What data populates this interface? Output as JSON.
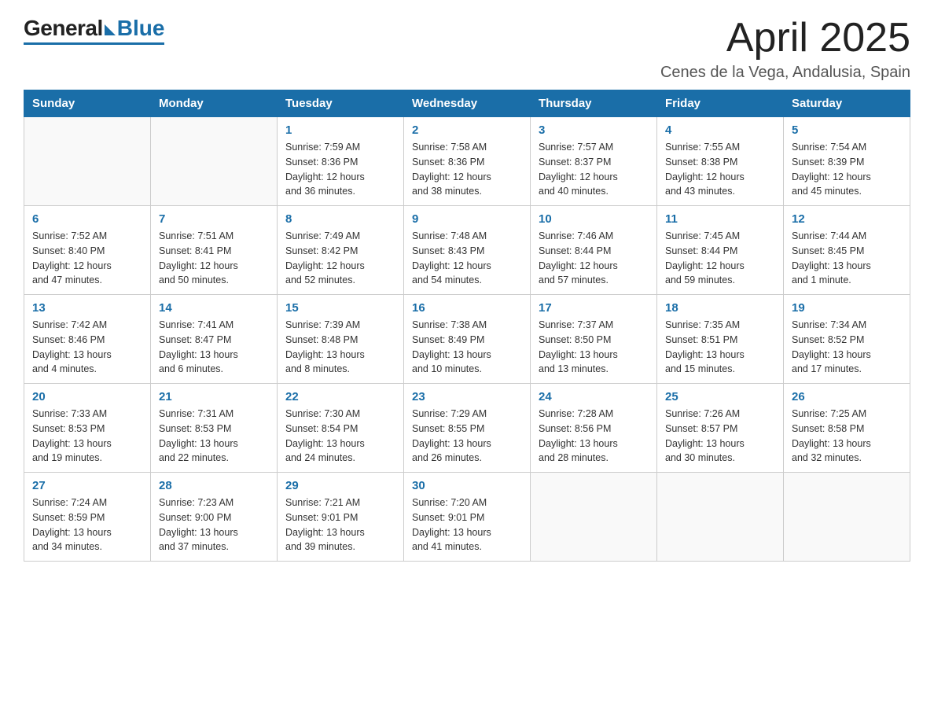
{
  "header": {
    "logo": {
      "general": "General",
      "blue": "Blue"
    },
    "title": "April 2025",
    "location": "Cenes de la Vega, Andalusia, Spain"
  },
  "calendar": {
    "weekdays": [
      "Sunday",
      "Monday",
      "Tuesday",
      "Wednesday",
      "Thursday",
      "Friday",
      "Saturday"
    ],
    "weeks": [
      [
        {
          "day": "",
          "info": ""
        },
        {
          "day": "",
          "info": ""
        },
        {
          "day": "1",
          "info": "Sunrise: 7:59 AM\nSunset: 8:36 PM\nDaylight: 12 hours\nand 36 minutes."
        },
        {
          "day": "2",
          "info": "Sunrise: 7:58 AM\nSunset: 8:36 PM\nDaylight: 12 hours\nand 38 minutes."
        },
        {
          "day": "3",
          "info": "Sunrise: 7:57 AM\nSunset: 8:37 PM\nDaylight: 12 hours\nand 40 minutes."
        },
        {
          "day": "4",
          "info": "Sunrise: 7:55 AM\nSunset: 8:38 PM\nDaylight: 12 hours\nand 43 minutes."
        },
        {
          "day": "5",
          "info": "Sunrise: 7:54 AM\nSunset: 8:39 PM\nDaylight: 12 hours\nand 45 minutes."
        }
      ],
      [
        {
          "day": "6",
          "info": "Sunrise: 7:52 AM\nSunset: 8:40 PM\nDaylight: 12 hours\nand 47 minutes."
        },
        {
          "day": "7",
          "info": "Sunrise: 7:51 AM\nSunset: 8:41 PM\nDaylight: 12 hours\nand 50 minutes."
        },
        {
          "day": "8",
          "info": "Sunrise: 7:49 AM\nSunset: 8:42 PM\nDaylight: 12 hours\nand 52 minutes."
        },
        {
          "day": "9",
          "info": "Sunrise: 7:48 AM\nSunset: 8:43 PM\nDaylight: 12 hours\nand 54 minutes."
        },
        {
          "day": "10",
          "info": "Sunrise: 7:46 AM\nSunset: 8:44 PM\nDaylight: 12 hours\nand 57 minutes."
        },
        {
          "day": "11",
          "info": "Sunrise: 7:45 AM\nSunset: 8:44 PM\nDaylight: 12 hours\nand 59 minutes."
        },
        {
          "day": "12",
          "info": "Sunrise: 7:44 AM\nSunset: 8:45 PM\nDaylight: 13 hours\nand 1 minute."
        }
      ],
      [
        {
          "day": "13",
          "info": "Sunrise: 7:42 AM\nSunset: 8:46 PM\nDaylight: 13 hours\nand 4 minutes."
        },
        {
          "day": "14",
          "info": "Sunrise: 7:41 AM\nSunset: 8:47 PM\nDaylight: 13 hours\nand 6 minutes."
        },
        {
          "day": "15",
          "info": "Sunrise: 7:39 AM\nSunset: 8:48 PM\nDaylight: 13 hours\nand 8 minutes."
        },
        {
          "day": "16",
          "info": "Sunrise: 7:38 AM\nSunset: 8:49 PM\nDaylight: 13 hours\nand 10 minutes."
        },
        {
          "day": "17",
          "info": "Sunrise: 7:37 AM\nSunset: 8:50 PM\nDaylight: 13 hours\nand 13 minutes."
        },
        {
          "day": "18",
          "info": "Sunrise: 7:35 AM\nSunset: 8:51 PM\nDaylight: 13 hours\nand 15 minutes."
        },
        {
          "day": "19",
          "info": "Sunrise: 7:34 AM\nSunset: 8:52 PM\nDaylight: 13 hours\nand 17 minutes."
        }
      ],
      [
        {
          "day": "20",
          "info": "Sunrise: 7:33 AM\nSunset: 8:53 PM\nDaylight: 13 hours\nand 19 minutes."
        },
        {
          "day": "21",
          "info": "Sunrise: 7:31 AM\nSunset: 8:53 PM\nDaylight: 13 hours\nand 22 minutes."
        },
        {
          "day": "22",
          "info": "Sunrise: 7:30 AM\nSunset: 8:54 PM\nDaylight: 13 hours\nand 24 minutes."
        },
        {
          "day": "23",
          "info": "Sunrise: 7:29 AM\nSunset: 8:55 PM\nDaylight: 13 hours\nand 26 minutes."
        },
        {
          "day": "24",
          "info": "Sunrise: 7:28 AM\nSunset: 8:56 PM\nDaylight: 13 hours\nand 28 minutes."
        },
        {
          "day": "25",
          "info": "Sunrise: 7:26 AM\nSunset: 8:57 PM\nDaylight: 13 hours\nand 30 minutes."
        },
        {
          "day": "26",
          "info": "Sunrise: 7:25 AM\nSunset: 8:58 PM\nDaylight: 13 hours\nand 32 minutes."
        }
      ],
      [
        {
          "day": "27",
          "info": "Sunrise: 7:24 AM\nSunset: 8:59 PM\nDaylight: 13 hours\nand 34 minutes."
        },
        {
          "day": "28",
          "info": "Sunrise: 7:23 AM\nSunset: 9:00 PM\nDaylight: 13 hours\nand 37 minutes."
        },
        {
          "day": "29",
          "info": "Sunrise: 7:21 AM\nSunset: 9:01 PM\nDaylight: 13 hours\nand 39 minutes."
        },
        {
          "day": "30",
          "info": "Sunrise: 7:20 AM\nSunset: 9:01 PM\nDaylight: 13 hours\nand 41 minutes."
        },
        {
          "day": "",
          "info": ""
        },
        {
          "day": "",
          "info": ""
        },
        {
          "day": "",
          "info": ""
        }
      ]
    ]
  }
}
